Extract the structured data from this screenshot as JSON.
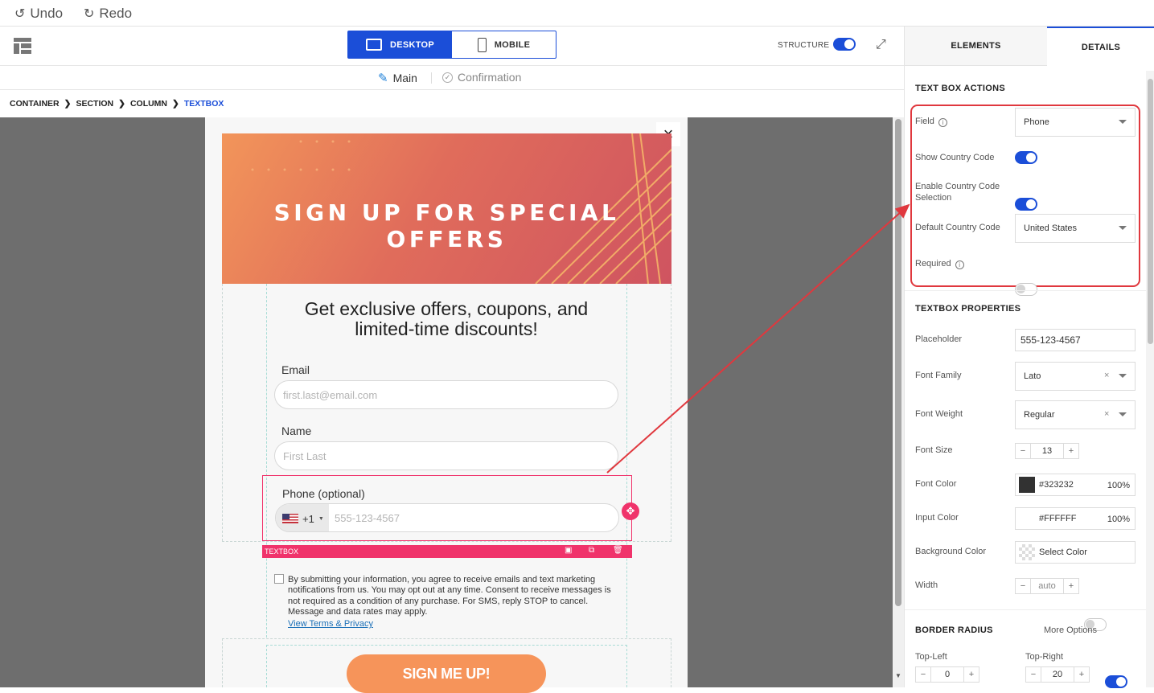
{
  "topbar": {
    "undo": "Undo",
    "redo": "Redo"
  },
  "toolbar": {
    "desktop": "DESKTOP",
    "mobile": "MOBILE",
    "structure": "STRUCTURE"
  },
  "pagetabs": {
    "main": "Main",
    "confirmation": "Confirmation"
  },
  "breadcrumb": [
    "CONTAINER",
    "SECTION",
    "COLUMN",
    "TEXTBOX"
  ],
  "popup": {
    "close": "×",
    "banner_title": "SIGN UP FOR SPECIAL OFFERS",
    "headline_line1": "Get exclusive offers, coupons, and",
    "headline_line2": "limited-time discounts!",
    "email_label": "Email",
    "email_placeholder": "first.last@email.com",
    "name_label": "Name",
    "name_placeholder": "First Last",
    "phone_label": "Phone (optional)",
    "phone_code": "+1",
    "phone_placeholder": "555-123-4567",
    "textbox_tag": "TEXTBOX",
    "consent": "By submitting your information, you agree to receive emails and text marketing notifications from us. You may opt out at any time. Consent to receive messages is not required as a condition of any purchase. For SMS, reply STOP to cancel. Message and data rates may apply.",
    "terms_link": "View Terms & Privacy",
    "submit": "SIGN ME UP!"
  },
  "sidebar": {
    "tab_elements": "ELEMENTS",
    "tab_details": "DETAILS",
    "actions_title": "TEXT BOX ACTIONS",
    "field_label": "Field",
    "field_value": "Phone",
    "show_cc_label": "Show Country Code",
    "enable_cc_label_1": "Enable Country Code",
    "enable_cc_label_2": "Selection",
    "default_cc_label": "Default Country Code",
    "default_cc_value": "United States",
    "required_label": "Required",
    "props_title": "TEXTBOX PROPERTIES",
    "placeholder_label": "Placeholder",
    "placeholder_value": "555-123-4567",
    "font_family_label": "Font Family",
    "font_family_value": "Lato",
    "font_weight_label": "Font Weight",
    "font_weight_value": "Regular",
    "font_size_label": "Font Size",
    "font_size_value": "13",
    "font_color_label": "Font Color",
    "font_color_value": "#323232",
    "font_color_opacity": "100%",
    "input_color_label": "Input Color",
    "input_color_value": "#FFFFFF",
    "input_color_opacity": "100%",
    "bg_color_label": "Background Color",
    "bg_color_value": "Select Color",
    "width_label": "Width",
    "width_value": "auto",
    "border_radius_title": "BORDER RADIUS",
    "more_options": "More Options",
    "top_left_label": "Top-Left",
    "top_left_value": "0",
    "top_right_label": "Top-Right",
    "top_right_value": "20",
    "minus": "−",
    "plus": "+",
    "clear": "×"
  },
  "colors": {
    "accent": "#1b4ed8",
    "highlight": "#e0383e",
    "selection": "#f0336b",
    "button": "#f6945a"
  }
}
